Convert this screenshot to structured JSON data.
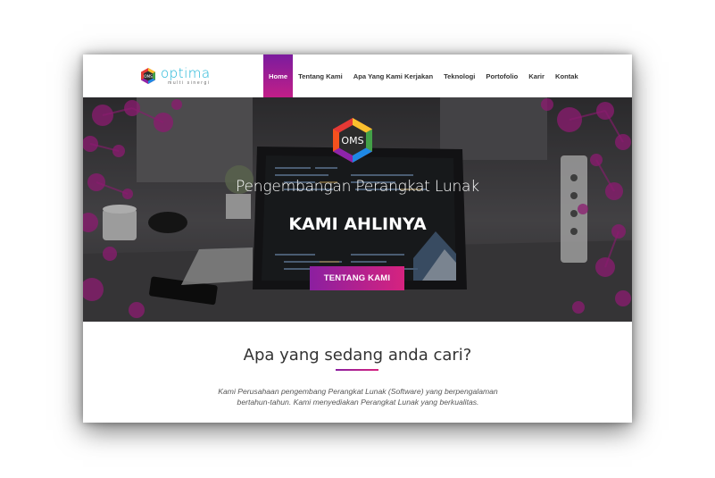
{
  "brand": {
    "badge_text": "OMS",
    "name": "optima",
    "tagline": "multi sinergi"
  },
  "nav": {
    "items": [
      {
        "label": "Home",
        "active": true
      },
      {
        "label": "Tentang Kami",
        "active": false
      },
      {
        "label": "Apa Yang Kami Kerjakan",
        "active": false
      },
      {
        "label": "Teknologi",
        "active": false
      },
      {
        "label": "Portofolio",
        "active": false
      },
      {
        "label": "Karir",
        "active": false
      },
      {
        "label": "Kontak",
        "active": false
      }
    ]
  },
  "hero": {
    "badge_text": "OMS",
    "title": "Pengembangan Perangkat Lunak",
    "subtitle": "KAMI AHLINYA",
    "cta_label": "TENTANG KAMI"
  },
  "section": {
    "title": "Apa yang sedang anda cari?",
    "body": "Kami Perusahaan pengembang Perangkat Lunak (Software) yang berpengalaman bertahun-tahun. Kami menyediakan Perangkat Lunak yang berkualitas."
  },
  "colors": {
    "accent_start": "#8b1fa0",
    "accent_end": "#d6237f",
    "logo_blue": "#1ab3d6"
  }
}
